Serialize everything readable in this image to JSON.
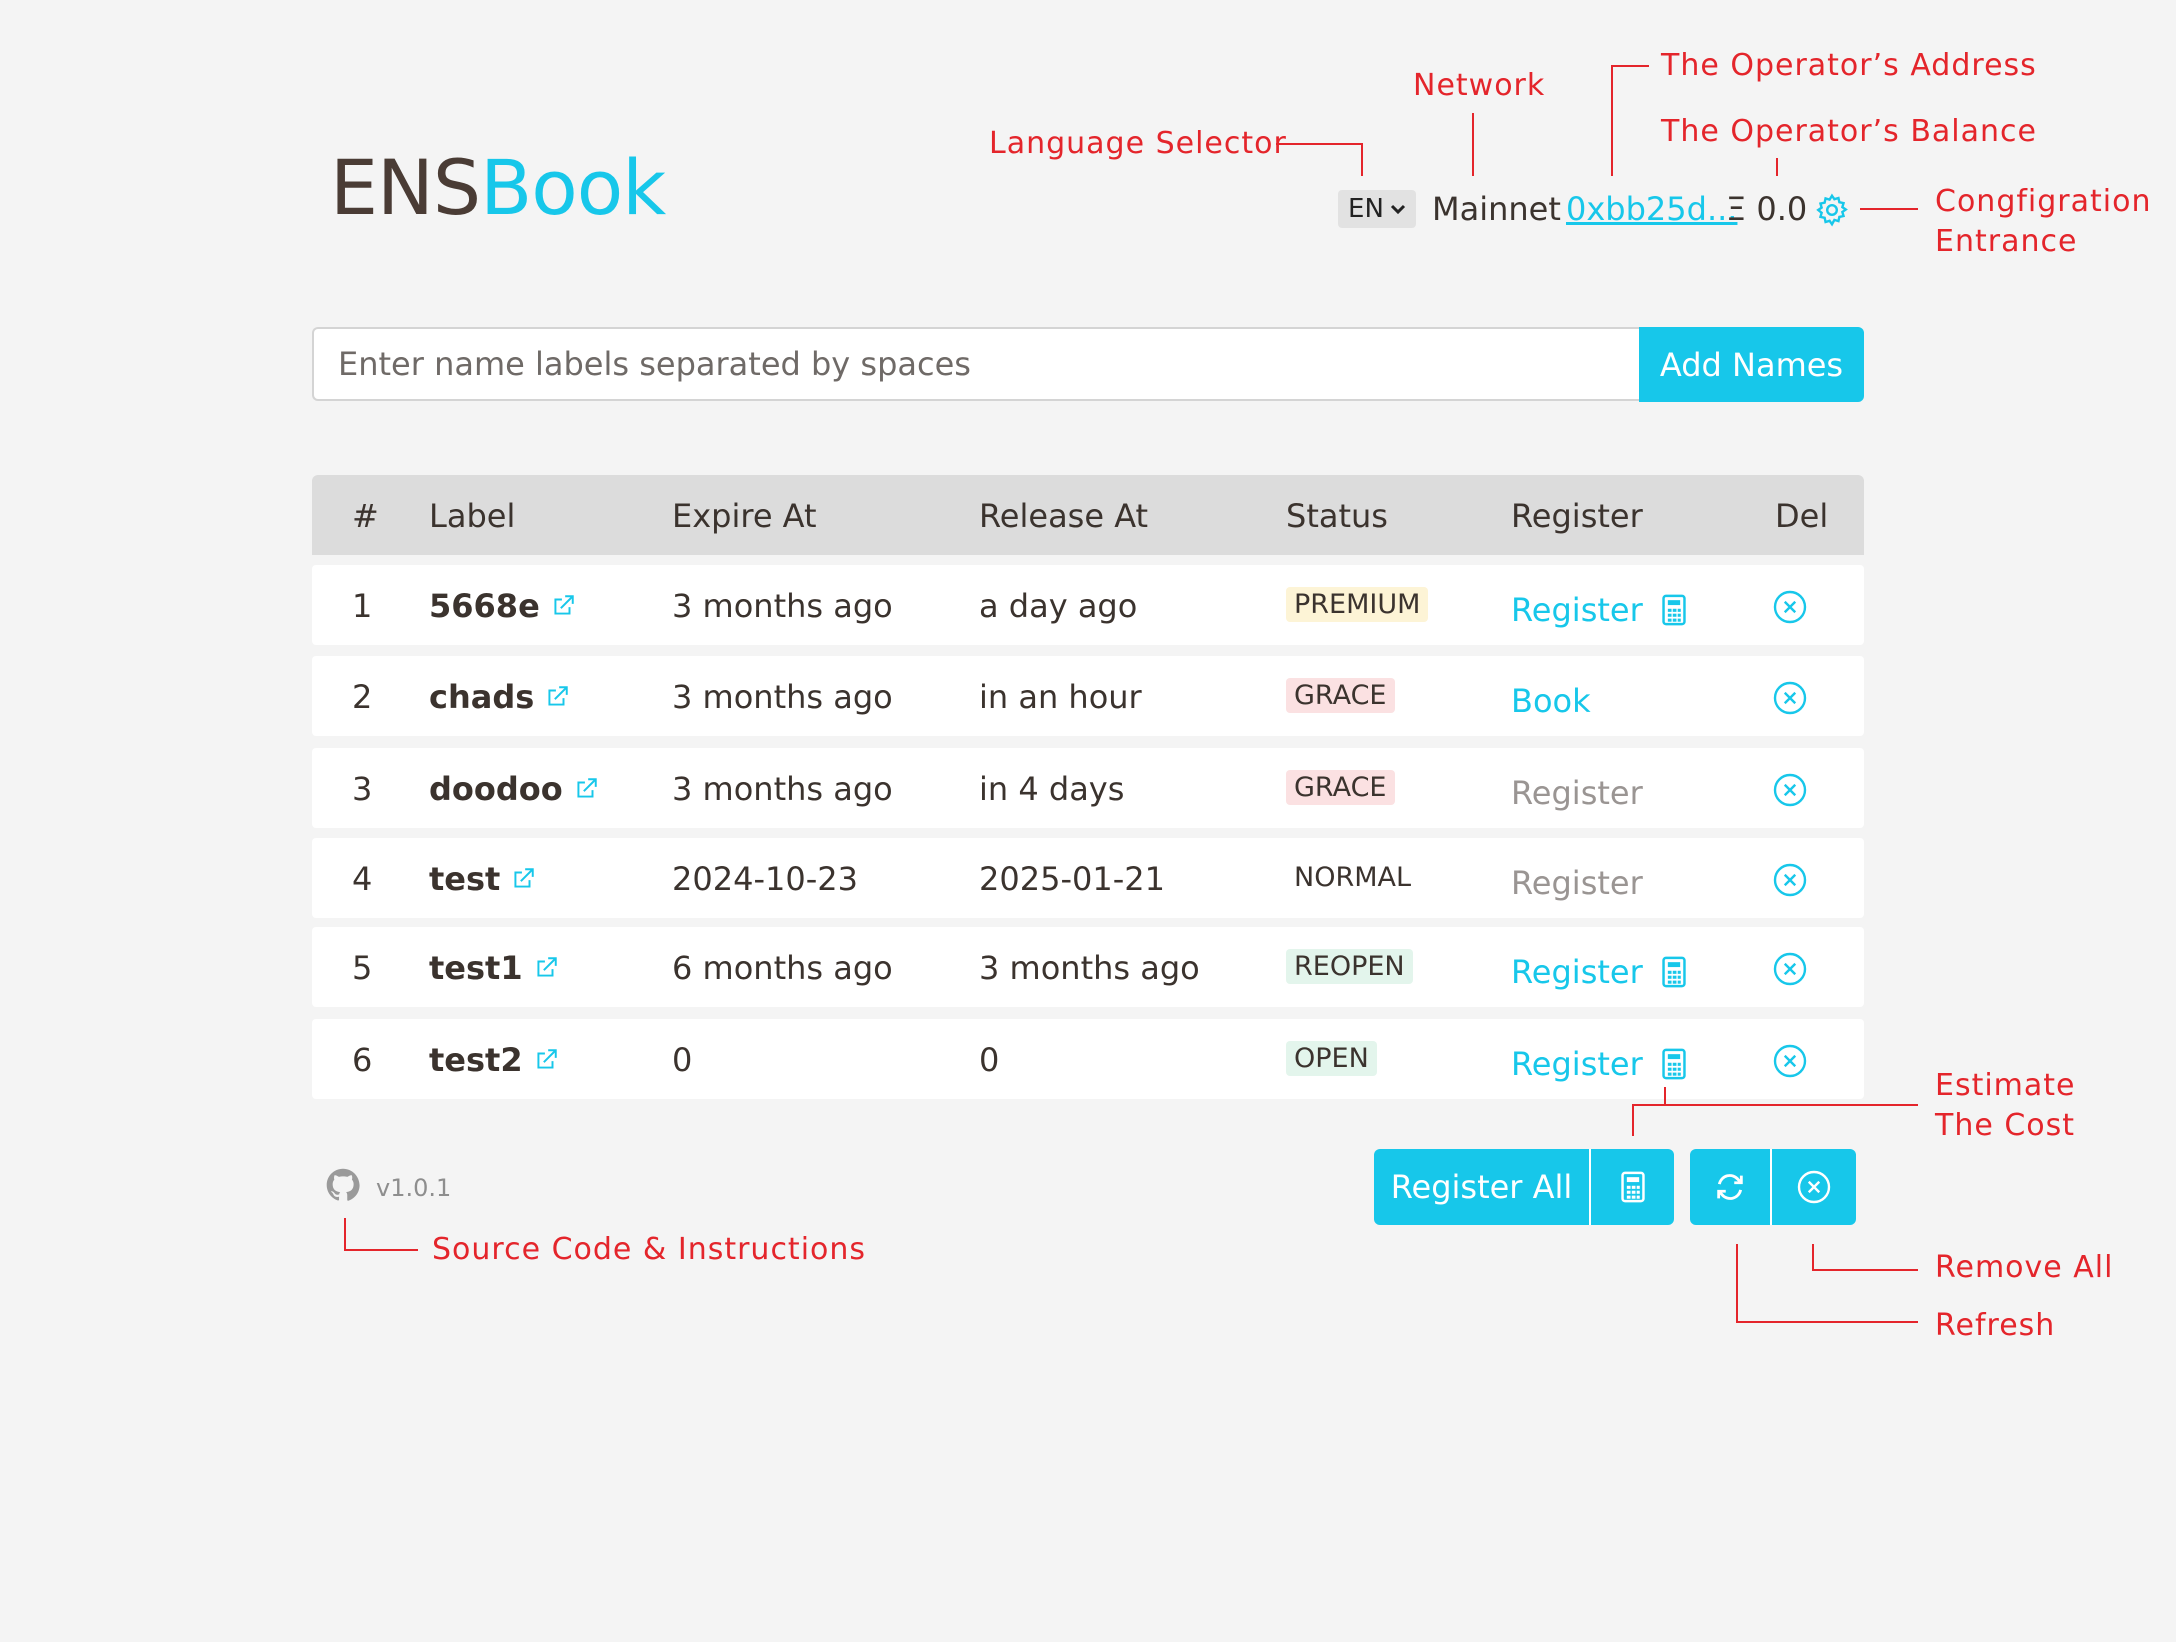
{
  "header": {
    "logo_part1": "ENS",
    "logo_part2": "Book",
    "language": "EN",
    "network": "Mainnet",
    "address": "0xbb25d...",
    "balance": "Ξ 0.0"
  },
  "input": {
    "placeholder": "Enter name labels separated by spaces",
    "add_label": "Add Names"
  },
  "table": {
    "headers": [
      "#",
      "Label",
      "Expire At",
      "Release At",
      "Status",
      "Register",
      "Del"
    ],
    "rows": [
      {
        "num": "1",
        "label": "5668e",
        "expire": "3 months ago",
        "release": "a day ago",
        "status": "PREMIUM",
        "register": "Register"
      },
      {
        "num": "2",
        "label": "chads",
        "expire": "3 months ago",
        "release": "in an hour",
        "status": "GRACE",
        "register": "Book"
      },
      {
        "num": "3",
        "label": "doodoo",
        "expire": "3 months ago",
        "release": "in 4 days",
        "status": "GRACE",
        "register": "Register"
      },
      {
        "num": "4",
        "label": "test",
        "expire": "2024-10-23",
        "release": "2025-01-21",
        "status": "NORMAL",
        "register": "Register"
      },
      {
        "num": "5",
        "label": "test1",
        "expire": "6 months ago",
        "release": "3 months ago",
        "status": "REOPEN",
        "register": "Register"
      },
      {
        "num": "6",
        "label": "test2",
        "expire": "0",
        "release": "0",
        "status": "OPEN",
        "register": "Register"
      }
    ]
  },
  "footer": {
    "version": "v1.0.1",
    "register_all": "Register All"
  },
  "annotations": {
    "network": "Network",
    "operator_address": "The Operator’s Address",
    "language_selector": "Language Selector",
    "operator_balance": "The Operator’s Balance",
    "config_line1": "Congfigration",
    "config_line2": "Entrance",
    "estimate_line1": "Estimate",
    "estimate_line2": "The Cost",
    "source_code": "Source Code & Instructions",
    "remove_all": "Remove All",
    "refresh": "Refresh"
  },
  "colors": {
    "accent": "#17c7ea",
    "annotation": "#e4252b",
    "background": "#f4f4f4"
  }
}
